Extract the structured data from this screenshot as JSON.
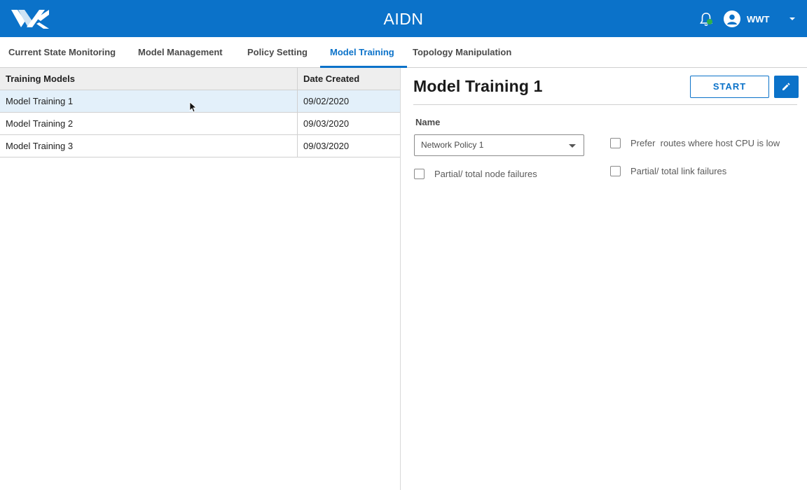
{
  "header": {
    "app_title": "AIDN",
    "user_name": "WWT",
    "logo_icon": "wwt-logo-icon",
    "notification_icon": "bell-icon",
    "avatar_icon": "person-avatar-icon",
    "accent_color": "#0b72c9"
  },
  "tabs": [
    {
      "label": "Current State Monitoring",
      "active": false
    },
    {
      "label": "Model Management",
      "active": false
    },
    {
      "label": "Policy Setting",
      "active": false
    },
    {
      "label": "Model Training",
      "active": true
    },
    {
      "label": "Topology Manipulation",
      "active": false
    }
  ],
  "table": {
    "columns": [
      "Training Models",
      "Date Created"
    ],
    "rows": [
      {
        "name": "Model Training 1",
        "date": "09/02/2020",
        "selected": true
      },
      {
        "name": "Model Training 2",
        "date": "09/03/2020",
        "selected": false
      },
      {
        "name": "Model Training 3",
        "date": "09/03/2020",
        "selected": false
      }
    ]
  },
  "detail": {
    "title": "Model Training 1",
    "start_label": "START",
    "edit_icon": "pencil-icon",
    "name_label": "Name",
    "policy_select": {
      "value": "Network Policy 1"
    },
    "options": [
      {
        "label": "Partial/ total node failures",
        "checked": false
      },
      {
        "label": "Prefer  routes where host CPU is low",
        "checked": false
      },
      {
        "label": "Partial/ total link failures",
        "checked": false
      }
    ]
  }
}
